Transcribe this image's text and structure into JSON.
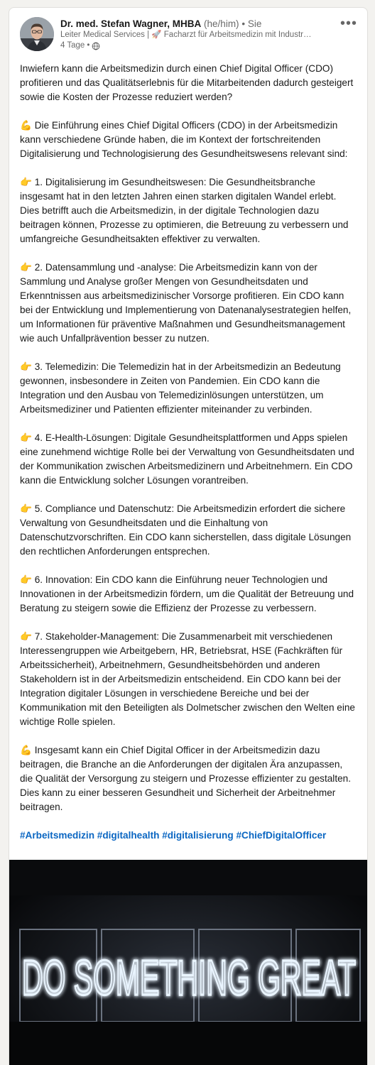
{
  "author": {
    "name": "Dr. med. Stefan Wagner, MHBA",
    "pronouns": "(he/him)",
    "connection": "Sie",
    "headline": "Leiter Medical Services | 🚀 Facharzt für Arbeitsmedizin mit Industr…",
    "time": "4 Tage"
  },
  "icons": {
    "more": "more-horizontal-icon",
    "globe": "globe-icon",
    "flexed_biceps": "flexed-biceps-icon",
    "pointing_hand": "backhand-index-pointing-right-icon",
    "rocket": "rocket-icon"
  },
  "post": {
    "intro": "Inwiefern kann die Arbeitsmedizin durch einen Chief Digital Officer (CDO) profitieren und das Qualitätserlebnis für die Mitarbeitenden dadurch gesteigert sowie die Kosten der Prozesse reduziert werden?",
    "lead": "Die Einführung eines Chief Digital Officers (CDO) in der Arbeitsmedizin kann verschiedene Gründe haben, die im Kontext der fortschreitenden Digitalisierung und Technologisierung des Gesundheitswesens relevant sind:",
    "points": [
      "1. Digitalisierung im Gesundheitswesen: Die Gesundheitsbranche insgesamt hat in den letzten Jahren einen starken digitalen Wandel erlebt. Dies betrifft auch die Arbeitsmedizin, in der digitale Technologien dazu beitragen können, Prozesse zu optimieren, die Betreuung zu verbessern und umfangreiche Gesundheitsakten effektiver zu verwalten.",
      "2. Datensammlung und -analyse: Die Arbeitsmedizin kann von der Sammlung und Analyse großer Mengen von Gesundheitsdaten und Erkenntnissen aus arbeitsmedizinischer Vorsorge profitieren. Ein CDO kann bei der Entwicklung und Implementierung von Datenanalysestrategien helfen, um Informationen für präventive Maßnahmen und Gesundheitsmanagement wie auch Unfallprävention besser zu nutzen.",
      "3. Telemedizin: Die Telemedizin hat in der Arbeitsmedizin an Bedeutung gewonnen, insbesondere in Zeiten von Pandemien. Ein CDO kann die Integration und den Ausbau von Telemedizinlösungen unterstützen, um Arbeitsmediziner und Patienten effizienter miteinander zu verbinden.",
      "4. E-Health-Lösungen: Digitale Gesundheitsplattformen und Apps spielen eine zunehmend wichtige Rolle bei der Verwaltung von Gesundheitsdaten und der Kommunikation zwischen Arbeitsmedizinern und Arbeitnehmern. Ein CDO kann die Entwicklung solcher Lösungen vorantreiben.",
      "5. Compliance und Datenschutz: Die Arbeitsmedizin erfordert die sichere Verwaltung von Gesundheitsdaten und die Einhaltung von Datenschutzvorschriften. Ein CDO kann sicherstellen, dass digitale Lösungen den rechtlichen Anforderungen entsprechen.",
      "6. Innovation: Ein CDO kann die Einführung neuer Technologien und Innovationen in der Arbeitsmedizin fördern, um die Qualität der Betreuung und Beratung zu steigern sowie die Effizienz der Prozesse zu verbessern.",
      "7. Stakeholder-Management: Die Zusammenarbeit mit verschiedenen Interessengruppen wie Arbeitgebern, HR, Betriebsrat, HSE (Fachkräften für Arbeitssicherheit), Arbeitnehmern, Gesundheitsbehörden und anderen Stakeholdern ist in der Arbeitsmedizin entscheidend. Ein CDO kann bei der Integration digitaler Lösungen in verschiedene Bereiche und bei der Kommunikation mit den Beteiligten als Dolmetscher zwischen den Welten eine wichtige Rolle spielen."
    ],
    "conclusion": "Insgesamt kann ein Chief Digital Officer in der Arbeitsmedizin dazu beitragen, die Branche an die Anforderungen der digitalen Ära anzupassen, die Qualität der Versorgung zu steigern und Prozesse effizienter zu gestalten. Dies kann zu einer besseren Gesundheit und Sicherheit der Arbeitnehmer beitragen.",
    "hashtags": [
      "#Arbeitsmedizin",
      "#digitalhealth",
      "#digitalisierung",
      "#ChiefDigitalOfficer"
    ]
  },
  "image": {
    "text": "DO SOMETHING GREAT"
  },
  "colors": {
    "link": "#0a66c2",
    "neon": "#e8f4ff"
  }
}
